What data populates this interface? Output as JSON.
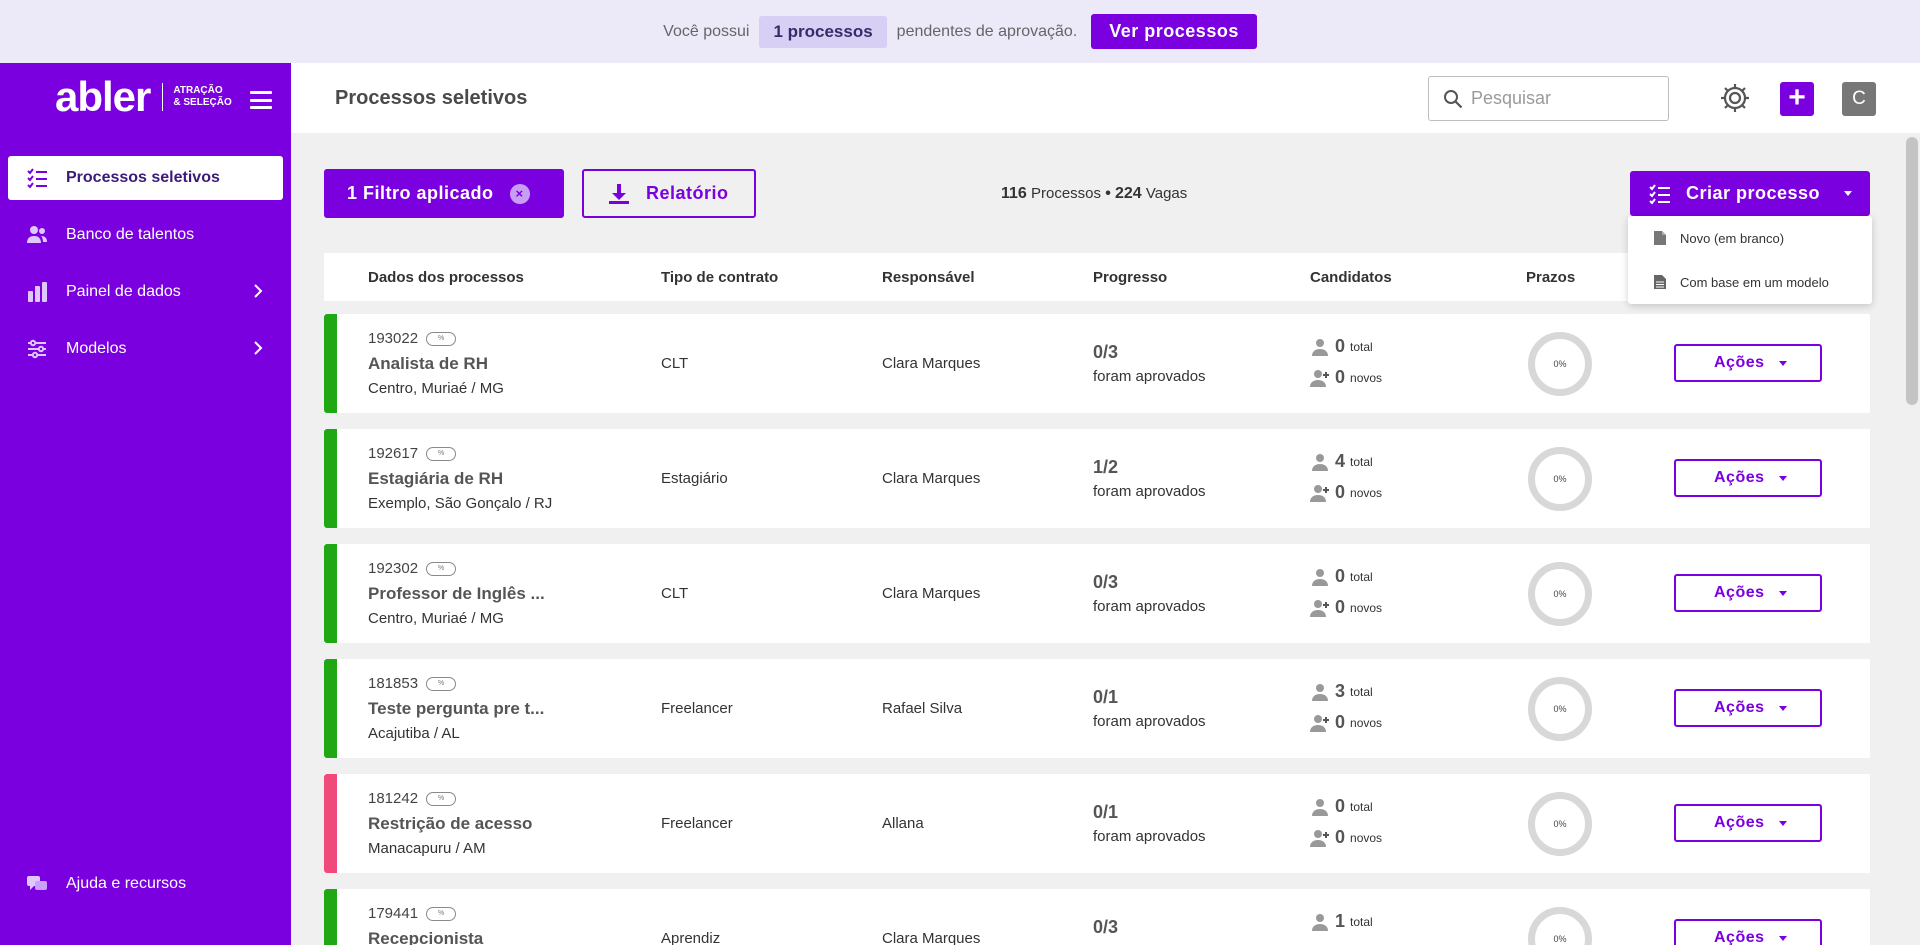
{
  "banner": {
    "prefix": "Você possui",
    "count": "1 processos",
    "suffix": "pendentes de aprovação.",
    "button": "Ver processos"
  },
  "brand": {
    "logo": "abler",
    "tag_line1": "ATRAÇÃO",
    "tag_line2": "& SELEÇÃO"
  },
  "sidebar": {
    "items": [
      {
        "label": "Processos seletivos",
        "icon": "checklist-icon",
        "active": true
      },
      {
        "label": "Banco de talentos",
        "icon": "people-icon"
      },
      {
        "label": "Painel de dados",
        "icon": "bar-chart-icon",
        "chevron": true
      },
      {
        "label": "Modelos",
        "icon": "sliders-icon",
        "chevron": true
      }
    ],
    "help": "Ajuda e recursos"
  },
  "header": {
    "title": "Processos seletivos",
    "search_placeholder": "Pesquisar",
    "add_label": "+",
    "avatar": "C"
  },
  "toolbar": {
    "filter_label": "1 Filtro aplicado",
    "filter_clear": "×",
    "report_label": "Relatório",
    "processes_count": "116",
    "processes_label": "Processos",
    "separator": "•",
    "vacancies_count": "224",
    "vacancies_label": "Vagas",
    "create_label": "Criar processo"
  },
  "dropdown": {
    "options": [
      "Novo (em branco)",
      "Com base em um modelo"
    ]
  },
  "table": {
    "headers": [
      "Dados dos processos",
      "Tipo de contrato",
      "Responsável",
      "Progresso",
      "Candidatos",
      "Prazos"
    ],
    "approved_label": "foram aprovados",
    "total_label": "total",
    "new_label": "novos",
    "actions_label": "Ações",
    "rows": [
      {
        "code": "193022",
        "title": "Analista de RH",
        "location": "Centro, Muriaé / MG",
        "contract": "CLT",
        "owner": "Clara Marques",
        "progress": "0/3",
        "total": "0",
        "new": "0",
        "deadline": "0%",
        "status_color": "#1fa814"
      },
      {
        "code": "192617",
        "title": "Estagiária de RH",
        "location": "Exemplo, São Gonçalo / RJ",
        "contract": "Estagiário",
        "owner": "Clara Marques",
        "progress": "1/2",
        "total": "4",
        "new": "0",
        "deadline": "0%",
        "status_color": "#1fa814"
      },
      {
        "code": "192302",
        "title": "Professor de Inglês ...",
        "location": "Centro, Muriaé / MG",
        "contract": "CLT",
        "owner": "Clara Marques",
        "progress": "0/3",
        "total": "0",
        "new": "0",
        "deadline": "0%",
        "status_color": "#1fa814"
      },
      {
        "code": "181853",
        "title": "Teste pergunta pre t...",
        "location": "Acajutiba / AL",
        "contract": "Freelancer",
        "owner": "Rafael Silva",
        "progress": "0/1",
        "total": "3",
        "new": "0",
        "deadline": "0%",
        "status_color": "#1fa814"
      },
      {
        "code": "181242",
        "title": "Restrição de acesso",
        "location": "Manacapuru / AM",
        "contract": "Freelancer",
        "owner": "Allana",
        "progress": "0/1",
        "total": "0",
        "new": "0",
        "deadline": "0%",
        "status_color": "#f04a7b"
      },
      {
        "code": "179441",
        "title": "Recepcionista",
        "location": "",
        "contract": "Aprendiz",
        "owner": "Clara Marques",
        "progress": "0/3",
        "total": "1",
        "new": "",
        "deadline": "0%",
        "status_color": "#1fa814"
      }
    ]
  },
  "colors": {
    "accent": "#7b00e0",
    "banner_bg": "#ece9f9",
    "active_status": "#1fa814",
    "alert_status": "#f04a7b"
  }
}
